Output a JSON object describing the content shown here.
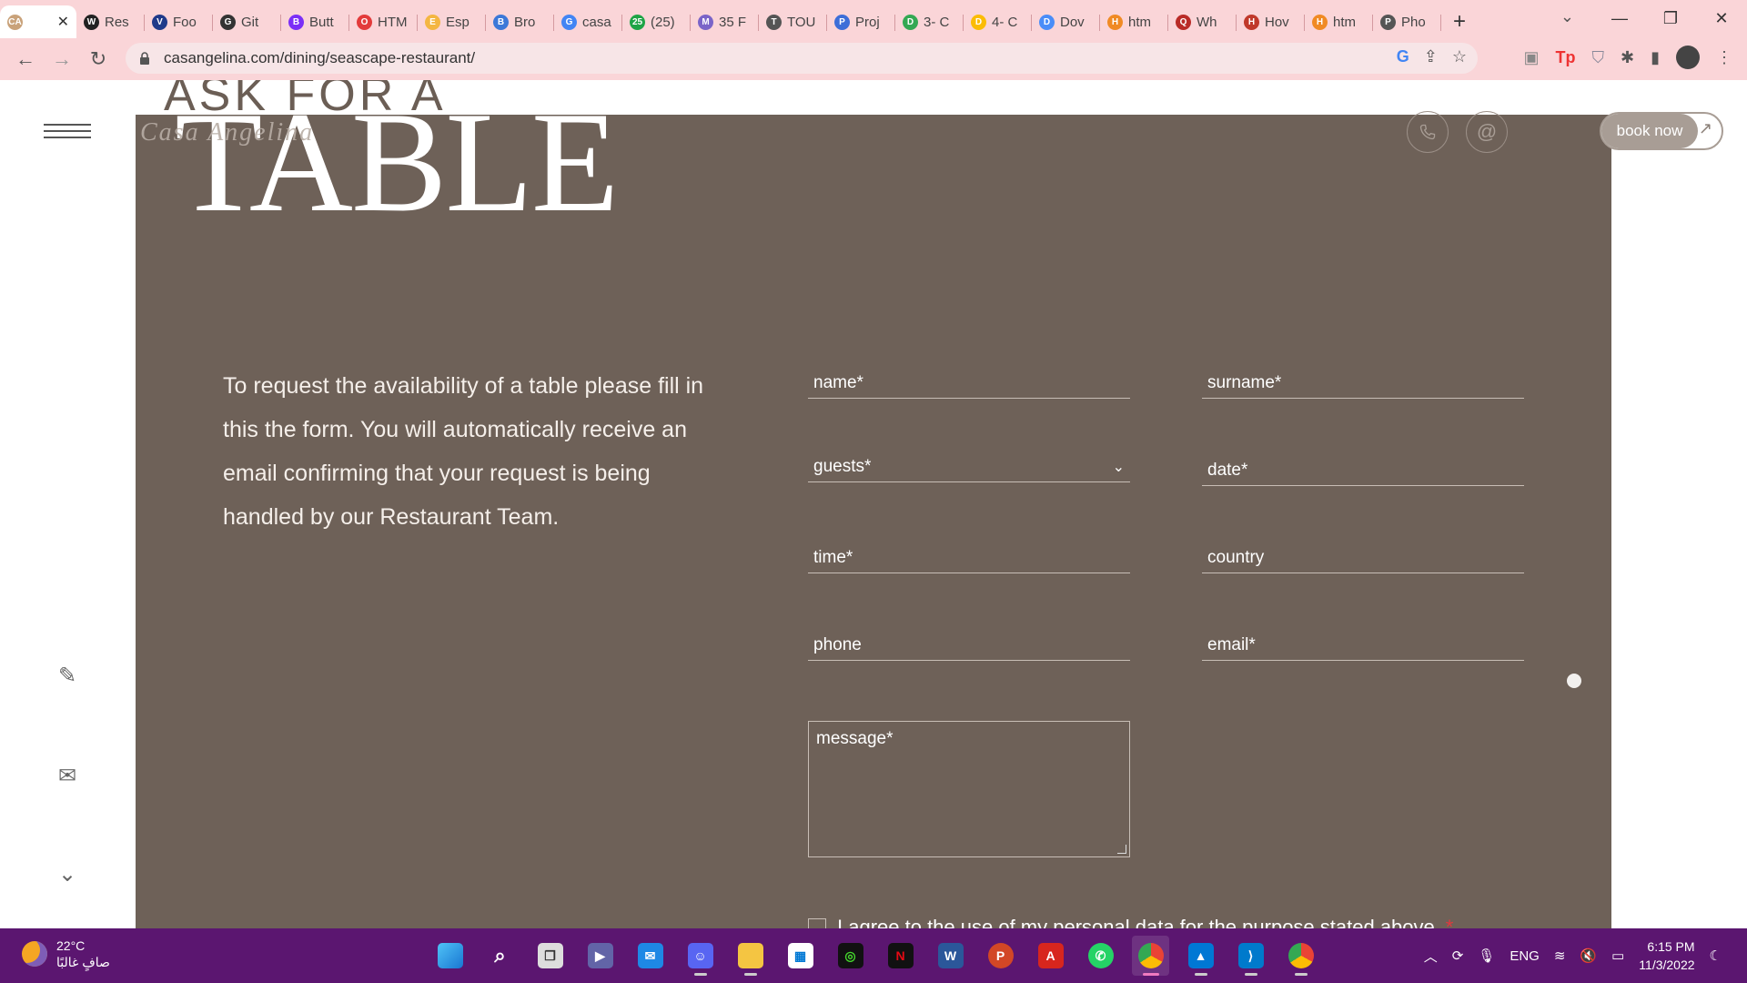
{
  "browser": {
    "tabs": [
      {
        "favicon": "CA",
        "favicon_color": "#c9a27a",
        "label": "",
        "active": true
      },
      {
        "favicon": "W",
        "favicon_color": "#222222",
        "label": "Res"
      },
      {
        "favicon": "V",
        "favicon_color": "#1f3a8a",
        "label": "Foo"
      },
      {
        "favicon": "G",
        "favicon_color": "#333333",
        "label": "Git"
      },
      {
        "favicon": "B",
        "favicon_color": "#7b2ff7",
        "label": "Butt"
      },
      {
        "favicon": "O",
        "favicon_color": "#e33b3b",
        "label": "HTM"
      },
      {
        "favicon": "E",
        "favicon_color": "#f4b642",
        "label": "Esp"
      },
      {
        "favicon": "B",
        "favicon_color": "#3c78d8",
        "label": "Bro"
      },
      {
        "favicon": "G",
        "favicon_color": "#4285f4",
        "label": "casa"
      },
      {
        "favicon": "25",
        "favicon_color": "#1ea446",
        "label": "(25)"
      },
      {
        "favicon": "M",
        "favicon_color": "#7a64c8",
        "label": "35 F"
      },
      {
        "favicon": "T",
        "favicon_color": "#555555",
        "label": "TOU"
      },
      {
        "favicon": "P",
        "favicon_color": "#3d6ed8",
        "label": "Proj"
      },
      {
        "favicon": "D",
        "favicon_color": "#34a853",
        "label": "3- C"
      },
      {
        "favicon": "D",
        "favicon_color": "#fbbc05",
        "label": "4- C"
      },
      {
        "favicon": "D",
        "favicon_color": "#4a8df8",
        "label": "Dov"
      },
      {
        "favicon": "H",
        "favicon_color": "#f08a24",
        "label": "htm"
      },
      {
        "favicon": "Q",
        "favicon_color": "#b92b27",
        "label": "Wh"
      },
      {
        "favicon": "H",
        "favicon_color": "#c0392b",
        "label": "Hov"
      },
      {
        "favicon": "H",
        "favicon_color": "#f08a24",
        "label": "htm"
      },
      {
        "favicon": "P",
        "favicon_color": "#555555",
        "label": "Pho"
      }
    ],
    "close_glyph": "✕",
    "new_tab_glyph": "+",
    "url": "casangelina.com/dining/seascape-restaurant/"
  },
  "page": {
    "heading_small": "ASK FOR A",
    "heading_big": "TABLE",
    "script_logo": "Casa Angelina",
    "book_now": "book now",
    "intro": "To request the availability of a table please fill in this the form. You will automatically receive an email confirming that your request is being handled by our Restaurant Team.",
    "form": {
      "name": "name*",
      "surname": "surname*",
      "guests": "guests*",
      "date": "date*",
      "time": "time*",
      "country": "country",
      "phone": "phone",
      "email": "email*",
      "message": "message*",
      "consent": "I agree to the use of my personal data for the purpose stated above",
      "consent_required": "*"
    },
    "colors": {
      "panel": "#6e6158",
      "button": "#a89d95"
    }
  },
  "taskbar": {
    "temperature": "22°C",
    "weather_desc": "صافٍ غالبًا",
    "language": "ENG",
    "time": "6:15 PM",
    "date": "11/3/2022"
  }
}
